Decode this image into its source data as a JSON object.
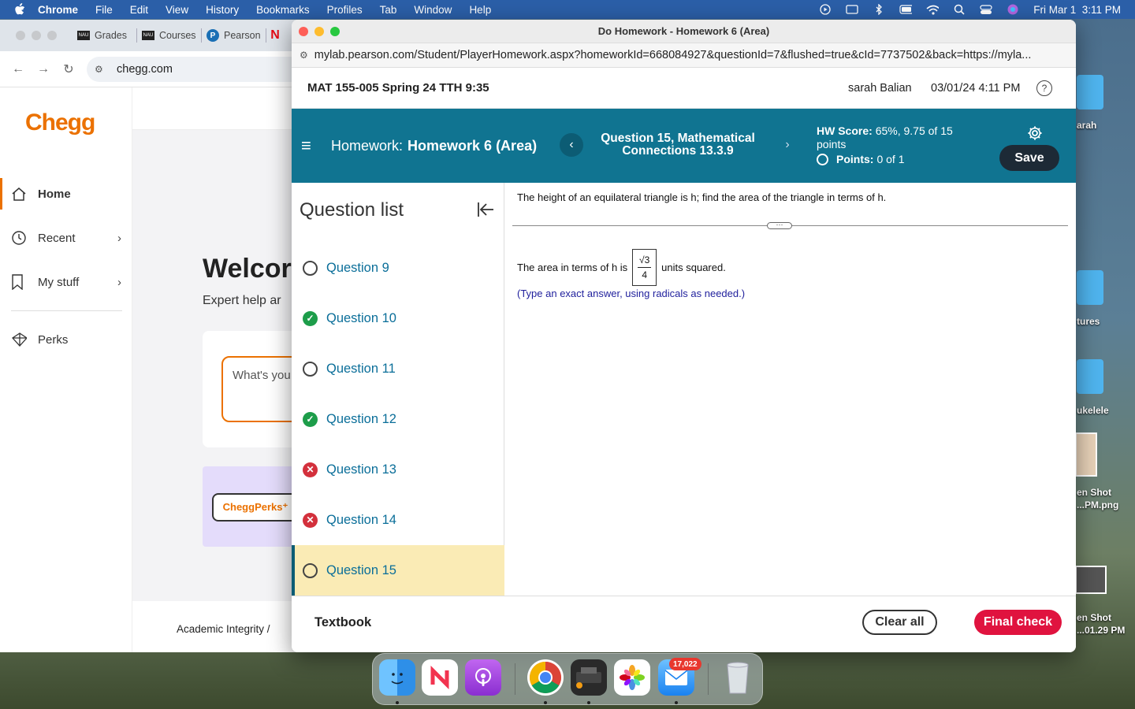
{
  "menubar": {
    "app": "Chrome",
    "items": [
      "File",
      "Edit",
      "View",
      "History",
      "Bookmarks",
      "Profiles",
      "Tab",
      "Window",
      "Help"
    ],
    "clock": "Fri Mar 1  3:11 PM"
  },
  "bg_browser": {
    "tabs": [
      "Grades",
      "Courses",
      "Pearson",
      ""
    ],
    "url": "chegg.com",
    "chegg": {
      "logo": "Chegg",
      "nav": [
        {
          "label": "Home",
          "icon": "home-icon"
        },
        {
          "label": "Recent",
          "icon": "clock-icon"
        },
        {
          "label": "My stuff",
          "icon": "bookmark-icon"
        },
        {
          "label": "Perks",
          "icon": "gift-icon"
        }
      ],
      "welcome": "Welcor",
      "expert_help": "Expert help ar",
      "search_placeholder": "What's you",
      "perks_badge": "CheggPerks⁺",
      "academic_integrity": "Academic Integrity  /"
    }
  },
  "desktop": {
    "labels": [
      "arah",
      "tures",
      "ukelele",
      "en Shot",
      "...PM.png",
      "en Shot",
      "...01.29 PM"
    ]
  },
  "pearson": {
    "window_title": "Do Homework - Homework 6 (Area)",
    "url": "mylab.pearson.com/Student/PlayerHomework.aspx?homeworkId=668084927&questionId=7&flushed=true&cId=7737502&back=https://myla...",
    "course": "MAT 155-005 Spring 24 TTH 9:35",
    "student": "sarah Balian",
    "datetime": "03/01/24 4:11 PM",
    "banner": {
      "homework_prefix": "Homework:",
      "homework_name": "Homework 6 (Area)",
      "question_title": "Question 15, Mathematical Connections 13.3.9",
      "hw_score_label": "HW Score:",
      "hw_score_value": "65%, 9.75 of 15 points",
      "points_label": "Points:",
      "points_value": "0 of 1",
      "save_label": "Save"
    },
    "question_list": {
      "title": "Question list",
      "items": [
        {
          "label": "Question 9",
          "status": "open"
        },
        {
          "label": "Question 10",
          "status": "correct"
        },
        {
          "label": "Question 11",
          "status": "open"
        },
        {
          "label": "Question 12",
          "status": "correct"
        },
        {
          "label": "Question 13",
          "status": "incorrect"
        },
        {
          "label": "Question 14",
          "status": "incorrect"
        },
        {
          "label": "Question 15",
          "status": "current"
        }
      ]
    },
    "question": {
      "prompt": "The height of an equilateral triangle is h; find the area of the triangle in terms of h.",
      "answer_prefix": "The area in terms of h is",
      "answer_numerator": "√3",
      "answer_denominator": "4",
      "answer_suffix": "units squared.",
      "hint": "(Type an exact answer, using radicals as needed.)"
    },
    "footer": {
      "textbook": "Textbook",
      "clear_all": "Clear all",
      "final_check": "Final check"
    }
  },
  "dock": {
    "apps": [
      "finder-icon",
      "news-icon",
      "podcasts-icon",
      "chrome-icon",
      "printer-icon",
      "photos-icon",
      "mail-icon",
      "trash-icon"
    ],
    "mail_badge": "17,022"
  },
  "colors": {
    "pearson_banner": "#107491",
    "chegg_orange": "#eb7100",
    "final_check": "#e0133f",
    "current_question_bg": "#faebb5"
  }
}
